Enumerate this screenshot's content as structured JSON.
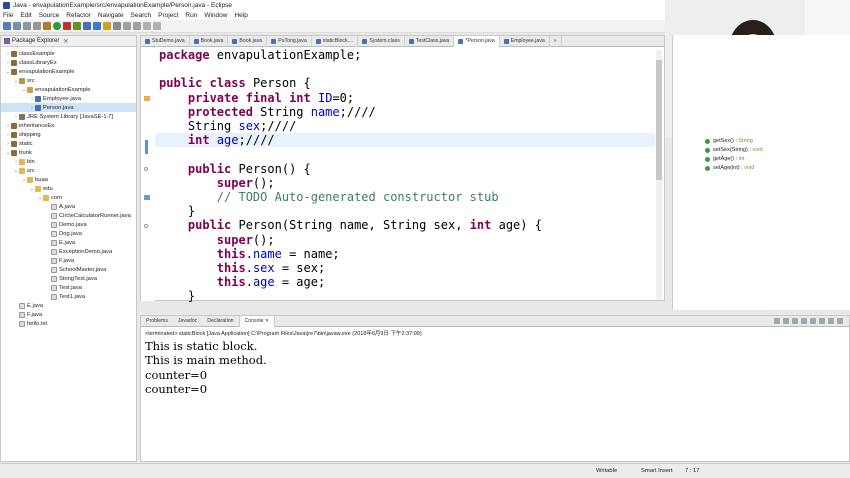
{
  "window": {
    "title": "Java - envapulationExample/src/envapulationExample/Person.java - Eclipse"
  },
  "menu": [
    "File",
    "Edit",
    "Source",
    "Refactor",
    "Navigate",
    "Search",
    "Project",
    "Run",
    "Window",
    "Help"
  ],
  "package_explorer": {
    "title": "Package Explorer",
    "items": [
      {
        "label": "classExample",
        "indent": 0,
        "tw": "›",
        "icon": "proj"
      },
      {
        "label": "classLibraryEx",
        "indent": 0,
        "tw": "›",
        "icon": "proj"
      },
      {
        "label": "envapulationExample",
        "indent": 0,
        "tw": "⌄",
        "icon": "proj"
      },
      {
        "label": "src",
        "indent": 1,
        "tw": "⌄",
        "icon": "src"
      },
      {
        "label": "envapulationExample",
        "indent": 2,
        "tw": "⌄",
        "icon": "pkg"
      },
      {
        "label": "Employee.java",
        "indent": 3,
        "tw": "›",
        "icon": "java"
      },
      {
        "label": "Person.java",
        "indent": 3,
        "tw": "›",
        "icon": "java",
        "selected": true
      },
      {
        "label": "JRE System Library [JavaSE-1.7]",
        "indent": 1,
        "tw": "›",
        "icon": "lib"
      },
      {
        "label": "inheritanceEx",
        "indent": 0,
        "tw": "›",
        "icon": "proj"
      },
      {
        "label": "shipping",
        "indent": 0,
        "tw": "›",
        "icon": "proj"
      },
      {
        "label": "static",
        "indent": 0,
        "tw": "›",
        "icon": "proj"
      },
      {
        "label": "trunk",
        "indent": 0,
        "tw": "⌄",
        "icon": "proj"
      },
      {
        "label": "bin",
        "indent": 1,
        "tw": "›",
        "icon": "folder"
      },
      {
        "label": "src",
        "indent": 1,
        "tw": "⌄",
        "icon": "folder"
      },
      {
        "label": "buaa",
        "indent": 2,
        "tw": "⌄",
        "icon": "folder"
      },
      {
        "label": "edu",
        "indent": 3,
        "tw": "⌄",
        "icon": "folder"
      },
      {
        "label": "com",
        "indent": 4,
        "tw": "⌄",
        "icon": "folder"
      },
      {
        "label": "A.java",
        "indent": 5,
        "tw": "",
        "icon": "file"
      },
      {
        "label": "CircleCalculatorRunner.java",
        "indent": 5,
        "tw": "",
        "icon": "file"
      },
      {
        "label": "Demo.java",
        "indent": 5,
        "tw": "",
        "icon": "file"
      },
      {
        "label": "Dog.java",
        "indent": 5,
        "tw": "",
        "icon": "file"
      },
      {
        "label": "E.java",
        "indent": 5,
        "tw": "",
        "icon": "file"
      },
      {
        "label": "ExceptionDemo.java",
        "indent": 5,
        "tw": "",
        "icon": "file"
      },
      {
        "label": "F.java",
        "indent": 5,
        "tw": "",
        "icon": "file"
      },
      {
        "label": "SchoolMaster.java",
        "indent": 5,
        "tw": "",
        "icon": "file"
      },
      {
        "label": "StringTest.java",
        "indent": 5,
        "tw": "",
        "icon": "file"
      },
      {
        "label": "Test.java",
        "indent": 5,
        "tw": "",
        "icon": "file"
      },
      {
        "label": "Test1.java",
        "indent": 5,
        "tw": "",
        "icon": "file"
      },
      {
        "label": "E.java",
        "indent": 1,
        "tw": "",
        "icon": "file"
      },
      {
        "label": "F.java",
        "indent": 1,
        "tw": "",
        "icon": "file"
      },
      {
        "label": "hello.txt",
        "indent": 1,
        "tw": "",
        "icon": "file"
      }
    ]
  },
  "editor": {
    "tabs": [
      "StuDemo.java",
      "Book.java",
      "Book.java",
      "PuTong.java",
      "staticBlock....",
      "System.class",
      "TestClass.java",
      "*Person.java",
      "Employee.java",
      "»"
    ],
    "active_tab": 7
  },
  "outline": {
    "items": [
      {
        "name": "getSex()",
        "type": "String"
      },
      {
        "name": "setSex(String)",
        "type": "void"
      },
      {
        "name": "getAge()",
        "type": "int"
      },
      {
        "name": "setAge(int)",
        "type": "void"
      }
    ]
  },
  "console": {
    "tabs": [
      "Problems",
      "Javadoc",
      "Declaration",
      "Console"
    ],
    "active_tab": 3,
    "status": "<terminated> staticBlock [Java Application] C:\\Program Files\\Java\\jre7\\bin\\javaw.exe (2018年6月9日 下午2:37:09)",
    "lines": [
      "This is static block.",
      "This is main method.",
      "counter=0",
      "counter=0"
    ]
  },
  "statusbar": {
    "mode": "Writable",
    "insert": "Smart Insert",
    "position": "7 : 17"
  }
}
